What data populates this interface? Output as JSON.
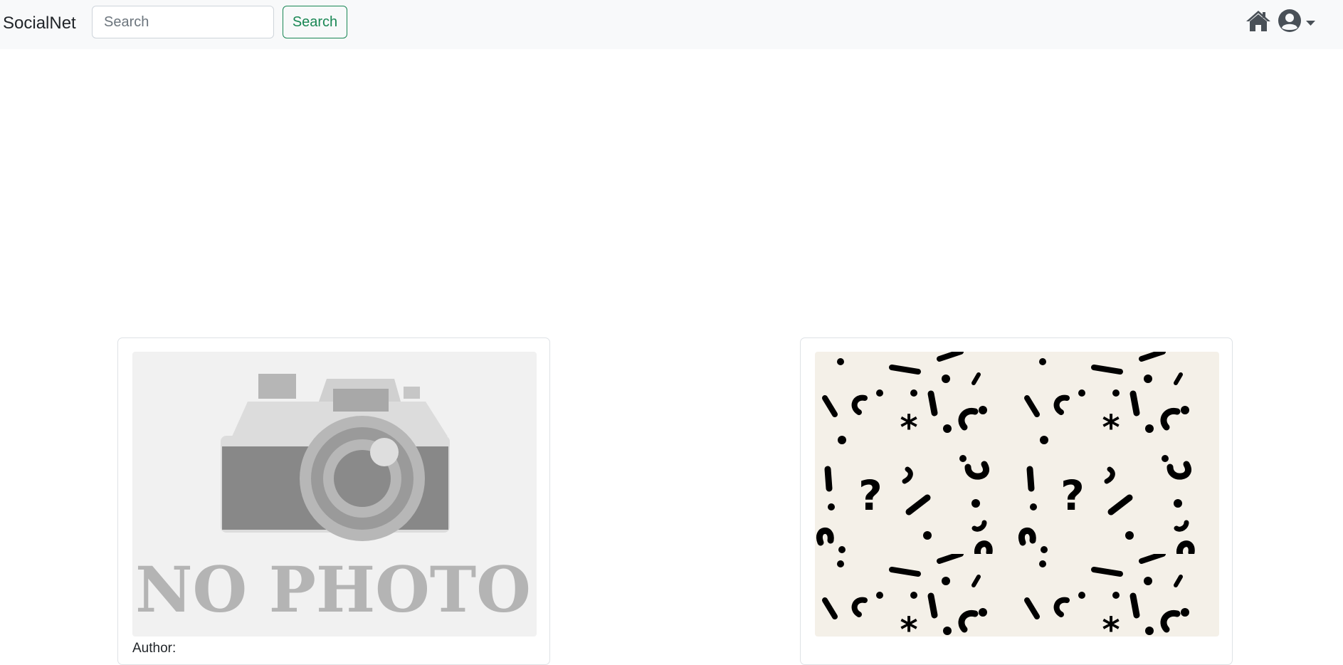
{
  "navbar": {
    "brand": "SocialNet",
    "search": {
      "placeholder": "Search",
      "value": "",
      "button_label": "Search"
    },
    "icons": {
      "home": "home-icon",
      "user": "user-circle-icon",
      "dropdown": "caret-down-icon"
    }
  },
  "posts": [
    {
      "image": "no-photo-placeholder",
      "image_text": "NO PHOTO",
      "author_label": "Author:"
    },
    {
      "image": "punctuation-pattern",
      "author_label": ""
    }
  ],
  "colors": {
    "navbar_bg": "#f8f9fa",
    "accent_success": "#198754",
    "pattern_bg": "#f4f0e8",
    "text": "#212529"
  }
}
